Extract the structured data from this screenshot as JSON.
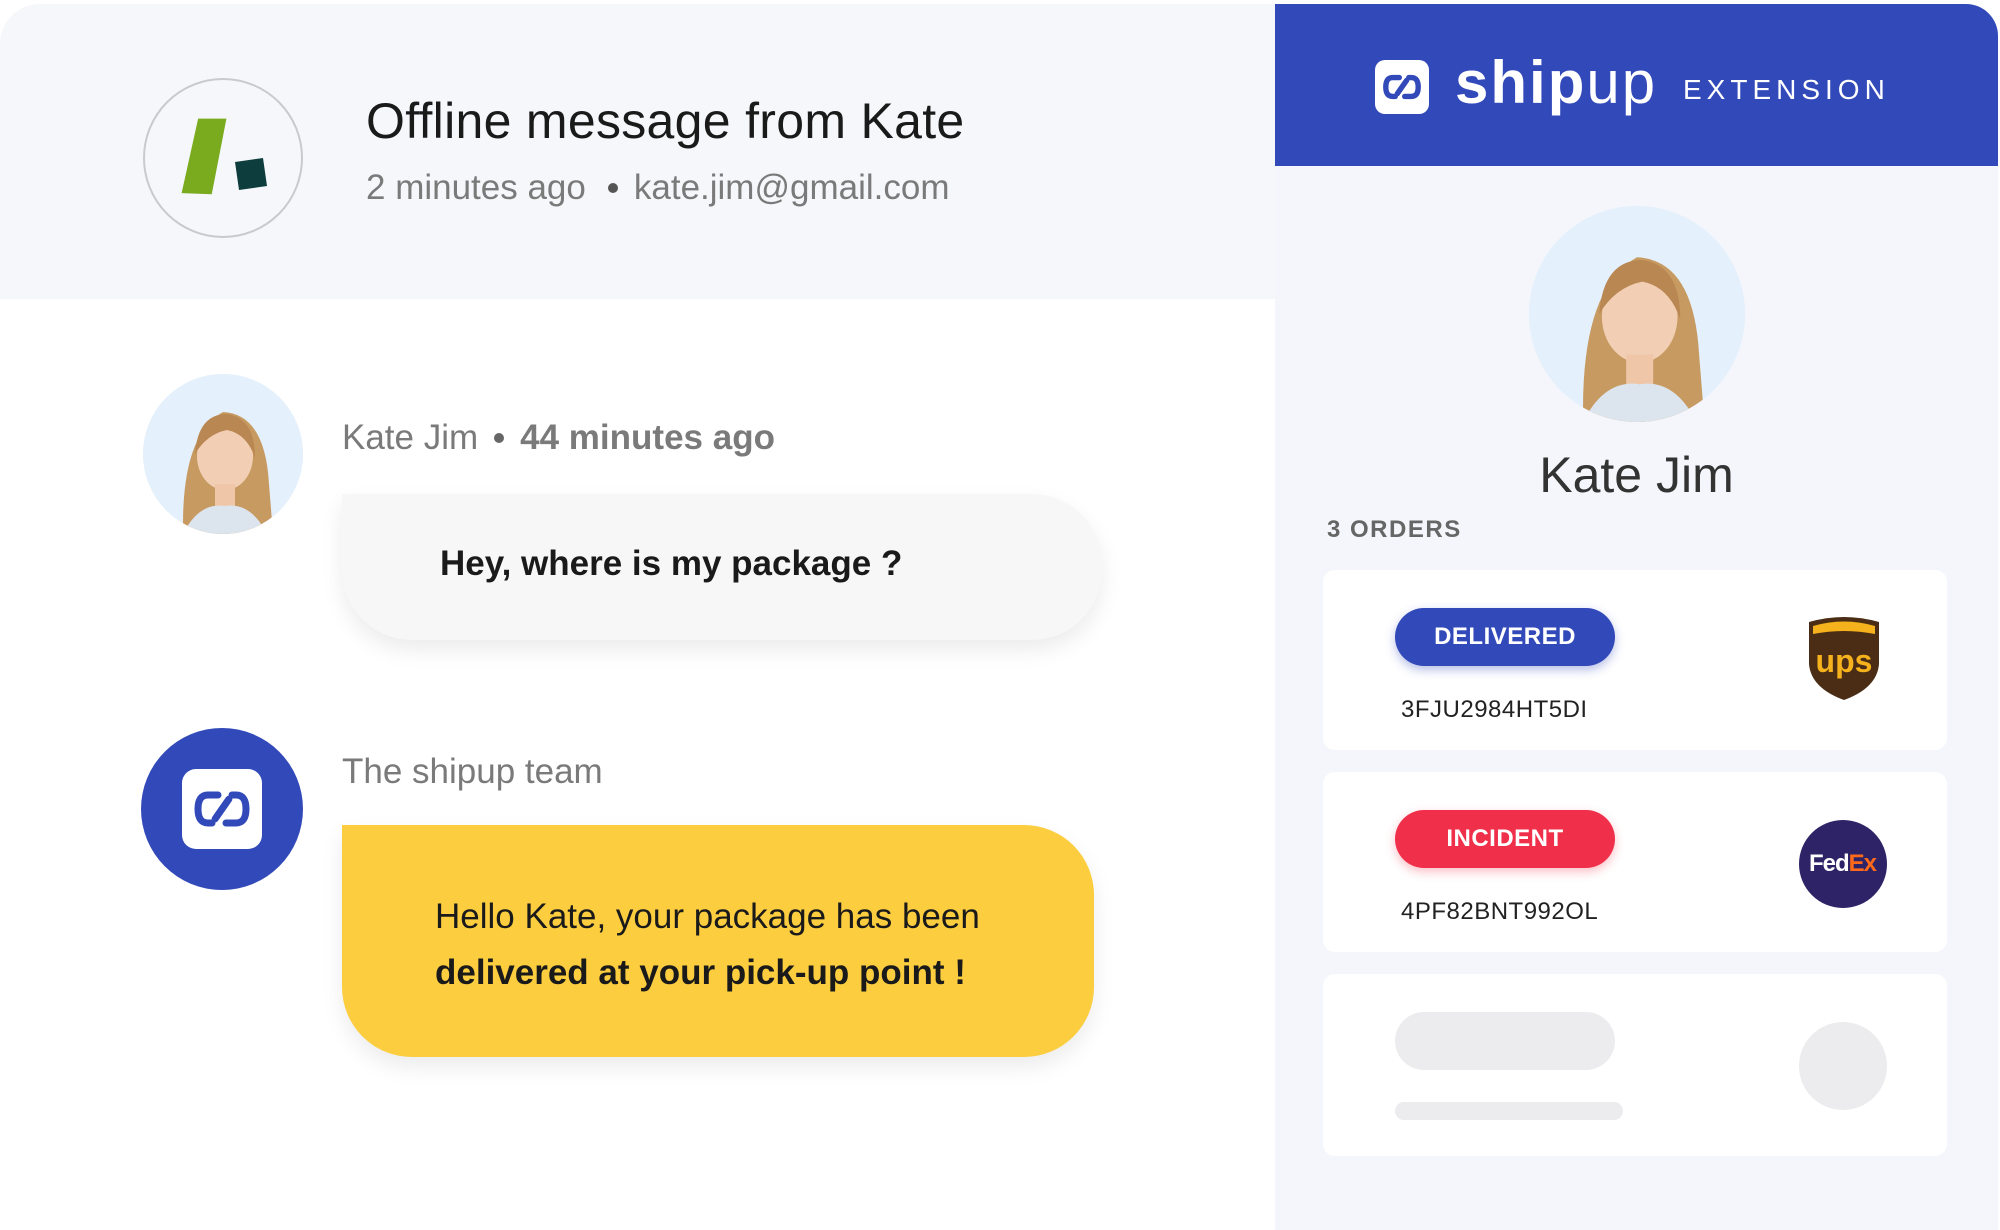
{
  "conversation": {
    "title": "Offline message from Kate",
    "time_ago": "2 minutes ago",
    "email": "kate.jim@gmail.com"
  },
  "messages": [
    {
      "sender": "Kate Jim",
      "time": "44 minutes ago",
      "text": "Hey, where is my package ?"
    },
    {
      "sender": "The shipup team",
      "text_line1": "Hello Kate, your package has been",
      "text_line2": "delivered at your pick-up point !"
    }
  ],
  "extension": {
    "brand_bold": "ship",
    "brand_light": "up",
    "label": "EXTENSION",
    "customer_name": "Kate Jim",
    "orders_label": "3  ORDERS",
    "orders": [
      {
        "status": "DELIVERED",
        "tracking": "3FJU2984HT5DI",
        "carrier": "ups-logo",
        "status_color": "#3249b9"
      },
      {
        "status": "INCIDENT",
        "tracking": "4PF82BNT992OL",
        "carrier": "fedex-logo",
        "status_color": "#f0304a"
      }
    ],
    "ups_text": "ups",
    "fedex_fed": "Fed",
    "fedex_ex": "Ex"
  },
  "colors": {
    "brand_blue": "#3249b9",
    "message_yellow": "#fbcd3f",
    "incident_red": "#f0304a",
    "header_bg": "#f5f7fa"
  },
  "icons": {
    "app_logo": "app-logo-icon",
    "shipup_logo": "shipup-logo-icon"
  }
}
